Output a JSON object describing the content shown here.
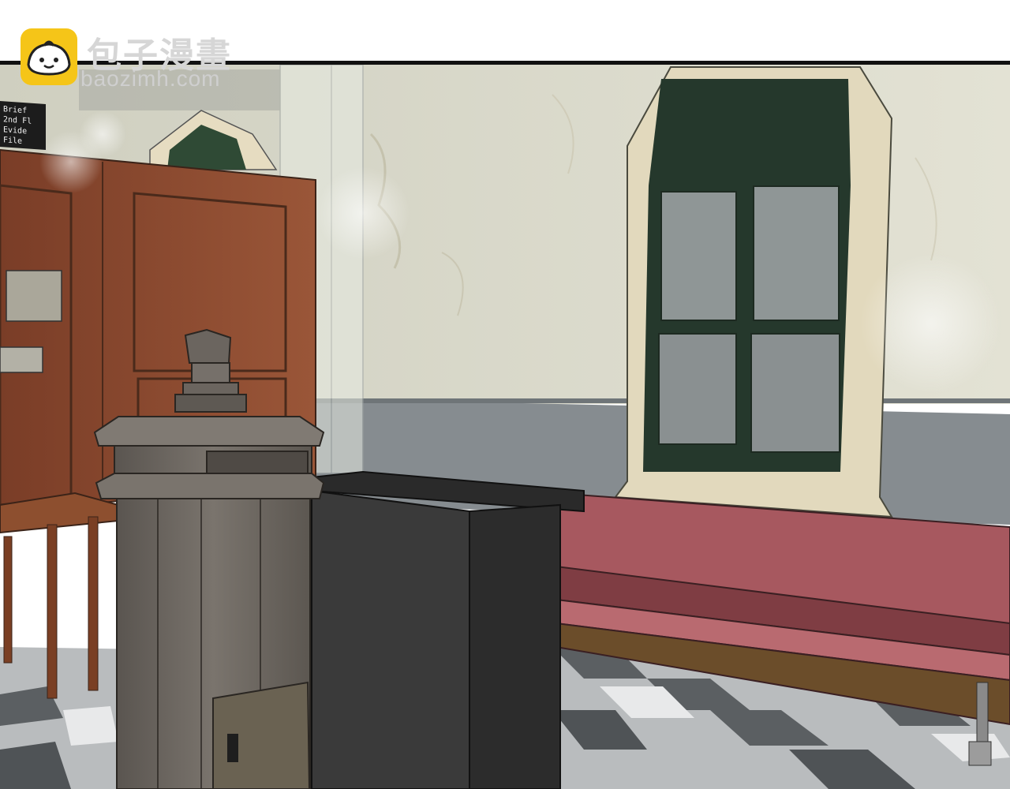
{
  "watermark": {
    "brand_name": "包子漫畫",
    "url": "baozimh.com",
    "logo_icon": "bun-face-icon"
  },
  "wall_sign": {
    "lines": [
      "Brief",
      "2nd Fl",
      "Evide",
      "File"
    ]
  },
  "colors": {
    "logo_yellow": "#f5c518",
    "wall": "#d9d8c8",
    "wainscot": "#8a8f93",
    "wood_panel": "#8b4a30",
    "bench_red": "#a7585f",
    "window_green": "#25382c",
    "stove_gray": "#6e6862",
    "cabinet_black": "#333333"
  }
}
